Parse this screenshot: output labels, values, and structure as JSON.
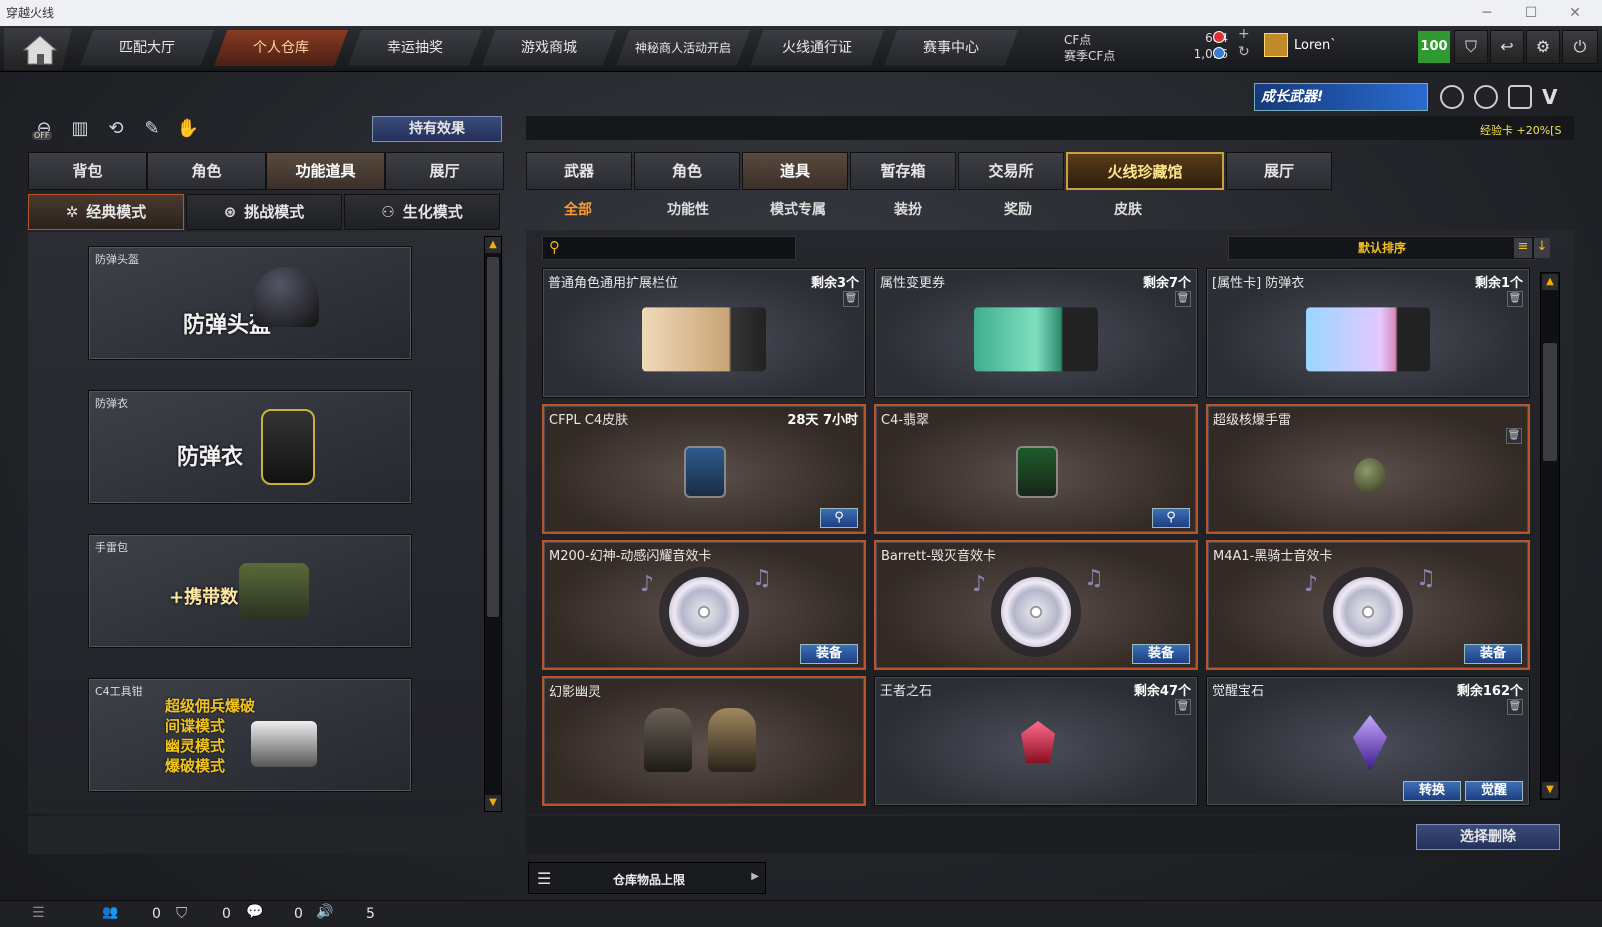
{
  "window": {
    "title": "穿越火线"
  },
  "nav": {
    "tabs": [
      "匹配大厅",
      "个人仓库",
      "幸运抽奖",
      "游戏商城",
      "神秘商人活动开启",
      "火线通行证",
      "赛事中心"
    ],
    "active_tab": "个人仓库"
  },
  "currency": {
    "cf_label": "CF点",
    "cf_value": "684",
    "season_label": "赛季CF点",
    "season_value": "1,016"
  },
  "user": {
    "name": "Loren`",
    "level": "100"
  },
  "banner": {
    "text": "成长武器!",
    "exp_card": "经验卡 +20%[S"
  },
  "left": {
    "quick_icons": [
      "toggle-off-icon",
      "stats-icon",
      "refresh-icon",
      "tool-icon",
      "glove-icon"
    ],
    "off_label": "OFF",
    "effects_button": "持有效果",
    "tabs": [
      "背包",
      "角色",
      "功能道具",
      "展厅"
    ],
    "active_tab": "功能道具",
    "modes": [
      "经典模式",
      "挑战模式",
      "生化模式"
    ],
    "active_mode": "经典模式",
    "cards": [
      {
        "label": "防弹头盔",
        "big": "防弹头盔"
      },
      {
        "label": "防弹衣",
        "big": "防弹衣"
      },
      {
        "label": "手雷包",
        "big": "+携带数"
      },
      {
        "label": "C4工具钳",
        "lines": [
          "超级佣兵爆破",
          "间谍模式",
          "幽灵模式",
          "爆破模式"
        ]
      }
    ]
  },
  "right": {
    "tabs": [
      "武器",
      "角色",
      "道具",
      "暂存箱",
      "交易所",
      "火线珍藏馆",
      "展厅"
    ],
    "active_tab": "道具",
    "highlight_tab": "火线珍藏馆",
    "subtabs": [
      "全部",
      "功能性",
      "模式专属",
      "装扮",
      "奖励",
      "皮肤"
    ],
    "active_subtab": "全部",
    "search_placeholder": "",
    "sort_label": "默认排序",
    "items": [
      {
        "name": "普通角色通用扩展栏位",
        "remain": "剩余3个",
        "trash": true
      },
      {
        "name": "属性变更券",
        "remain": "剩余7个",
        "trash": true
      },
      {
        "name": "[属性卡] 防弹衣",
        "remain": "剩余1个",
        "trash": true
      },
      {
        "name": "CFPL C4皮肤",
        "remain": "28天 7小时",
        "magnify": true,
        "selected": true
      },
      {
        "name": "C4-翡翠",
        "remain": "",
        "magnify": true,
        "selected": true
      },
      {
        "name": "超级核爆手雷",
        "remain": "",
        "trash": true,
        "selected": true
      },
      {
        "name": "M200-幻神-动感闪耀音效卡",
        "remain": "",
        "button": "装备",
        "selected": true
      },
      {
        "name": "Barrett-毁灭音效卡",
        "remain": "",
        "button": "装备",
        "selected": true
      },
      {
        "name": "M4A1-黑骑士音效卡",
        "remain": "",
        "button": "装备",
        "selected": true
      },
      {
        "name": "幻影幽灵",
        "remain": "",
        "selected": true
      },
      {
        "name": "王者之石",
        "remain": "剩余47个",
        "trash": true
      },
      {
        "name": "觉醒宝石",
        "remain": "剩余162个",
        "trash": true,
        "buttons": [
          "转换",
          "觉醒"
        ]
      }
    ],
    "delete_button": "选择删除",
    "capacity_label": "仓库物品上限"
  },
  "status": {
    "friends": "0",
    "shield": "0",
    "chat": "0",
    "volume": "5"
  }
}
